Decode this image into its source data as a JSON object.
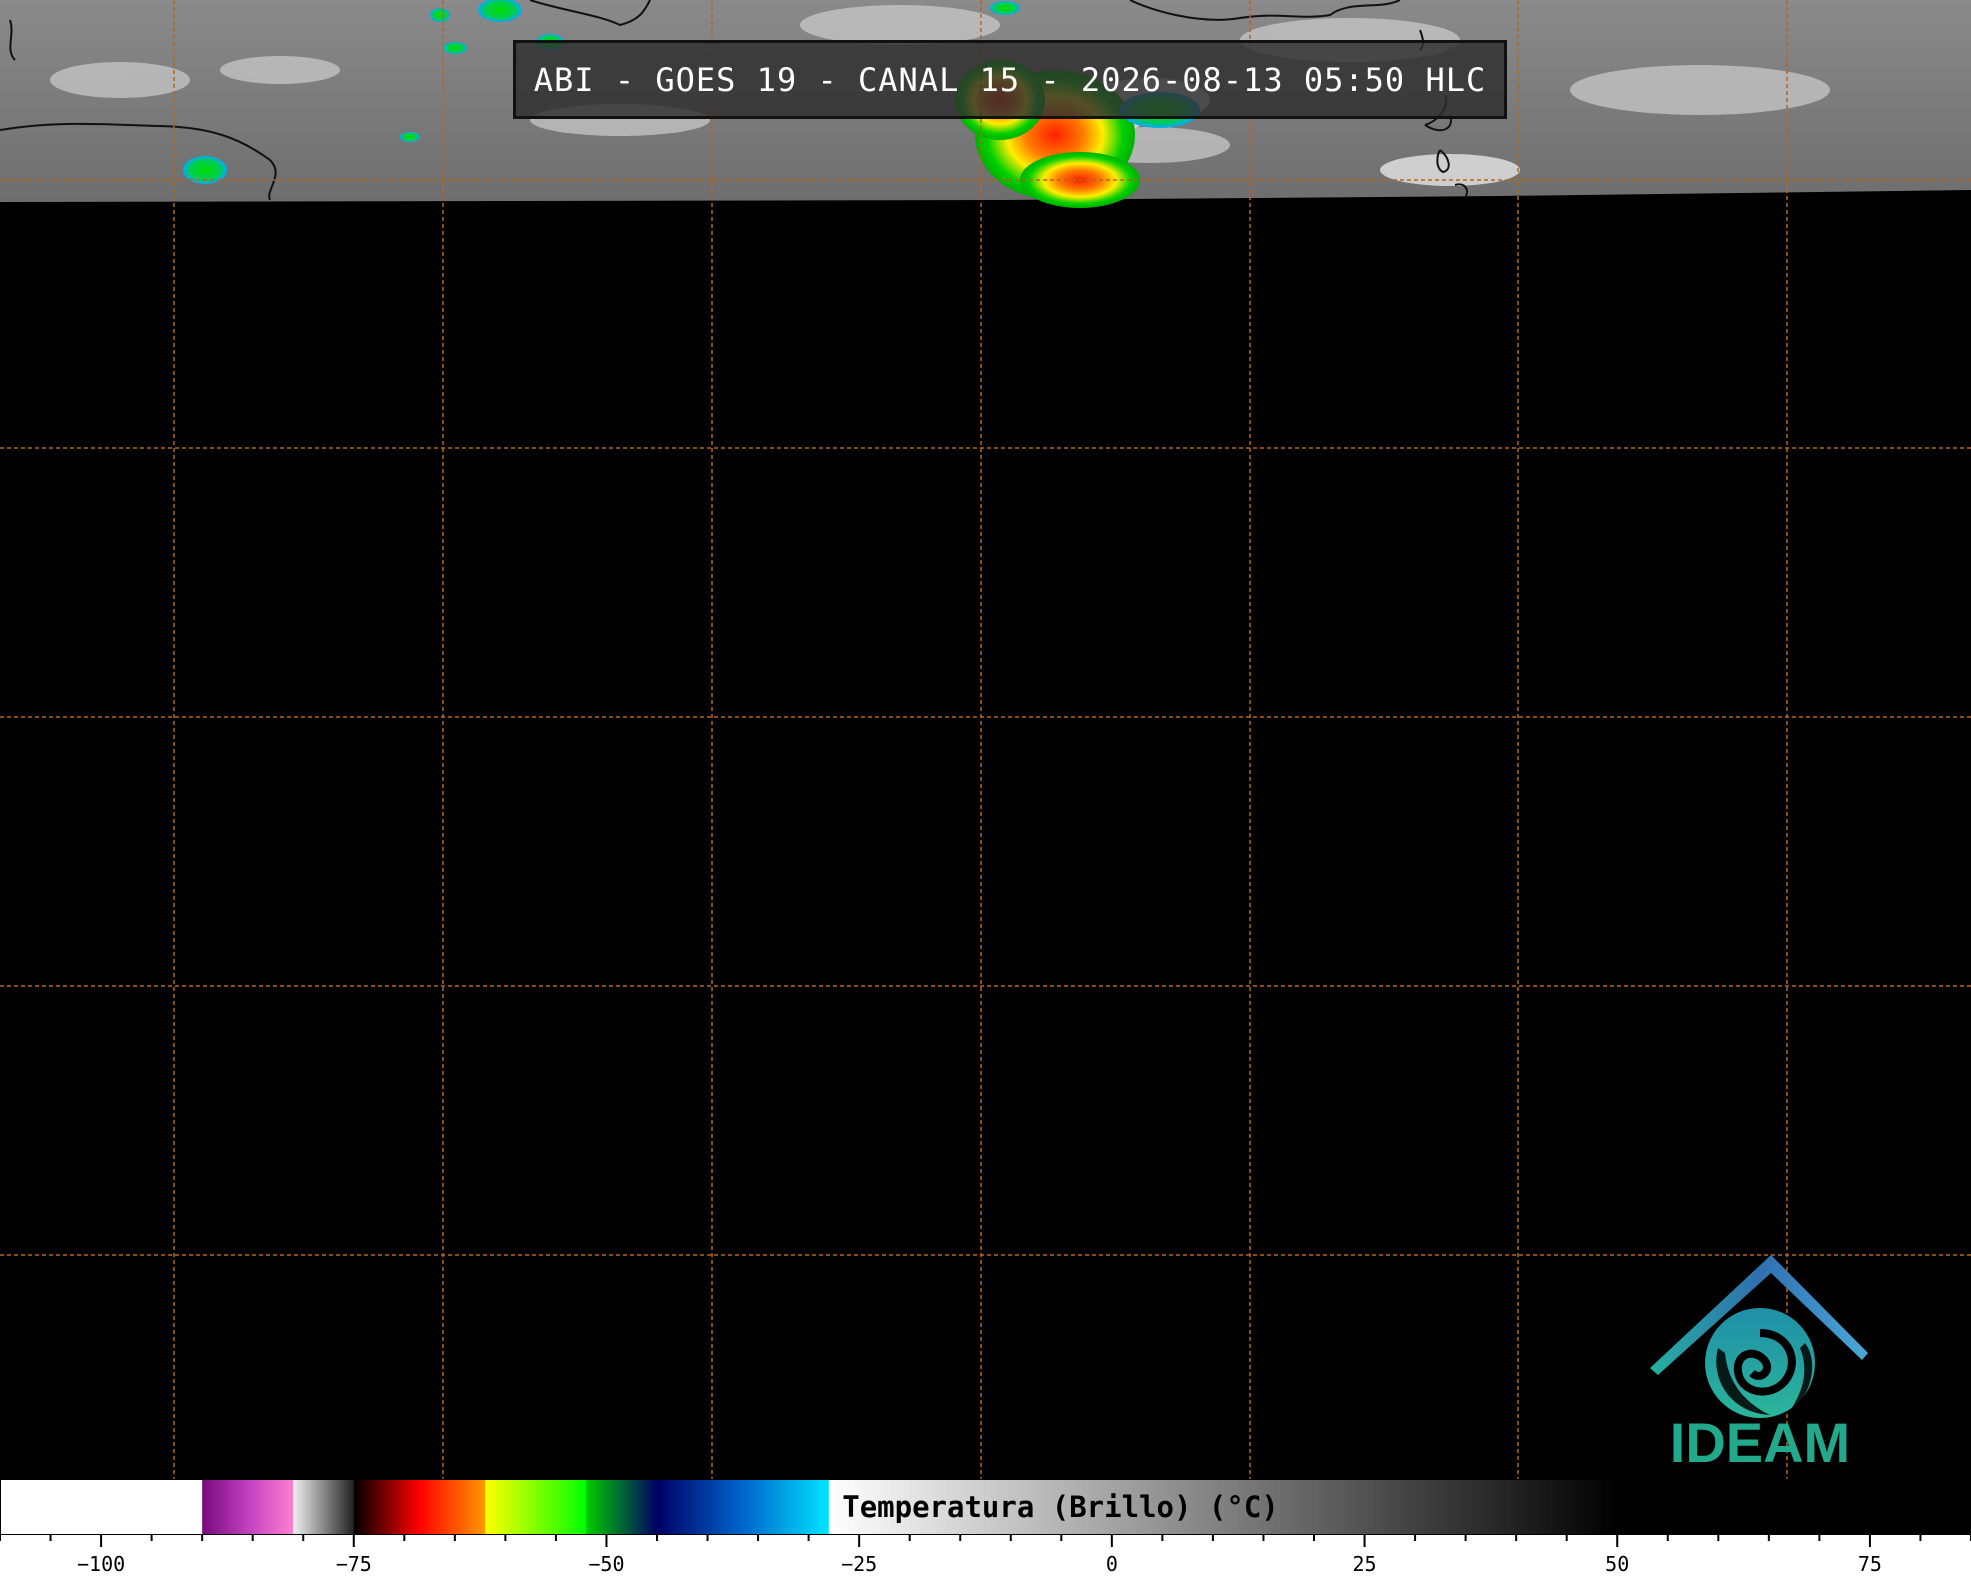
{
  "title": "ABI - GOES 19 - CANAL 15 - 2026-08-13 05:50 HLC",
  "colorbar": {
    "label": "Temperatura (Brillo) (°C)",
    "range": [
      -110,
      85
    ],
    "major_ticks": [
      -100,
      -75,
      -50,
      -25,
      0,
      25,
      50,
      75
    ],
    "major_tick_labels": [
      "−100",
      "−75",
      "−50",
      "−25",
      "0",
      "25",
      "50",
      "75"
    ],
    "minor_tick_step": 5,
    "color_segments": [
      {
        "from": -110,
        "to": -90,
        "color": "#ffffff"
      },
      {
        "from": -90,
        "to": -81,
        "colors": [
          "#7a0a7a",
          "#c040c0",
          "#ff80d0"
        ]
      },
      {
        "from": -81,
        "to": -75,
        "colors": [
          "#f0f0f0",
          "#202020"
        ]
      },
      {
        "from": -75,
        "to": -62,
        "colors": [
          "#000000",
          "#ff0000",
          "#ff9900"
        ]
      },
      {
        "from": -62,
        "to": -52,
        "colors": [
          "#ffff00",
          "#00ff00"
        ]
      },
      {
        "from": -52,
        "to": -45,
        "colors": [
          "#00cc00",
          "#000066"
        ]
      },
      {
        "from": -45,
        "to": -28,
        "colors": [
          "#000066",
          "#0066cc",
          "#00e5ff"
        ]
      },
      {
        "from": -28,
        "to": 50,
        "colors": [
          "#ffffff",
          "#000000"
        ]
      },
      {
        "from": 50,
        "to": 85,
        "color": "#000000"
      }
    ]
  },
  "map": {
    "grid_color": "#b5651d",
    "coverage": "only northern strip of imagery is present; rest is no-data black"
  },
  "logo": {
    "text": "IDEAM",
    "icon": "ideam-logo-icon",
    "color": "#22a88a"
  }
}
